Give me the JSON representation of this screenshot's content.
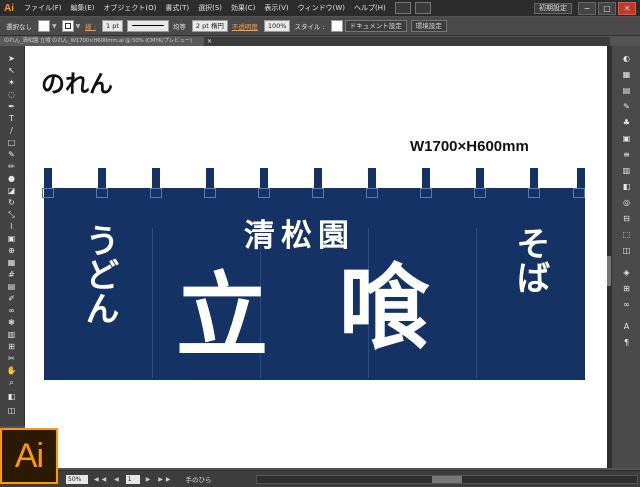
{
  "app": {
    "logo_text": "Ai",
    "menu": [
      "ファイル(F)",
      "編集(E)",
      "オブジェクト(O)",
      "書式(T)",
      "選択(S)",
      "効果(C)",
      "表示(V)",
      "ウィンドウ(W)",
      "ヘルプ(H)"
    ],
    "workspace_label": "初期設定",
    "window_buttons": [
      "−",
      "□",
      "✕"
    ]
  },
  "control_bar": {
    "selection_status": "選択なし",
    "stroke_label": "線 :",
    "stroke_weight": "1 pt",
    "stroke_style": "均等",
    "brush": "2 pt 楕円",
    "opacity_label": "不透明度",
    "opacity_value": "100%",
    "style_label": "スタイル :",
    "doc_setup_button": "ドキュメント設定",
    "prefs_button": "環境設定"
  },
  "document": {
    "tab_title": "のれん_清松園 立喰 のれん_W1700×H600mm.ai @ 50% (CMYK/プレビュー)",
    "tab_close": "✕"
  },
  "artboard": {
    "title": "のれん",
    "dimensions": "W1700×H600mm",
    "noren": {
      "left_text": "うどん",
      "right_text": "そば",
      "shop_name": "清松園",
      "main_left": "立",
      "main_right": "喰",
      "color": "#143264"
    }
  },
  "status": {
    "zoom": "50%",
    "page": "1",
    "tool_name": "手のひら"
  },
  "colors": {
    "accent": "#ff9a00",
    "noren_navy": "#143264",
    "ui_dark": "#535353"
  },
  "brand_logo_text": "Ai"
}
